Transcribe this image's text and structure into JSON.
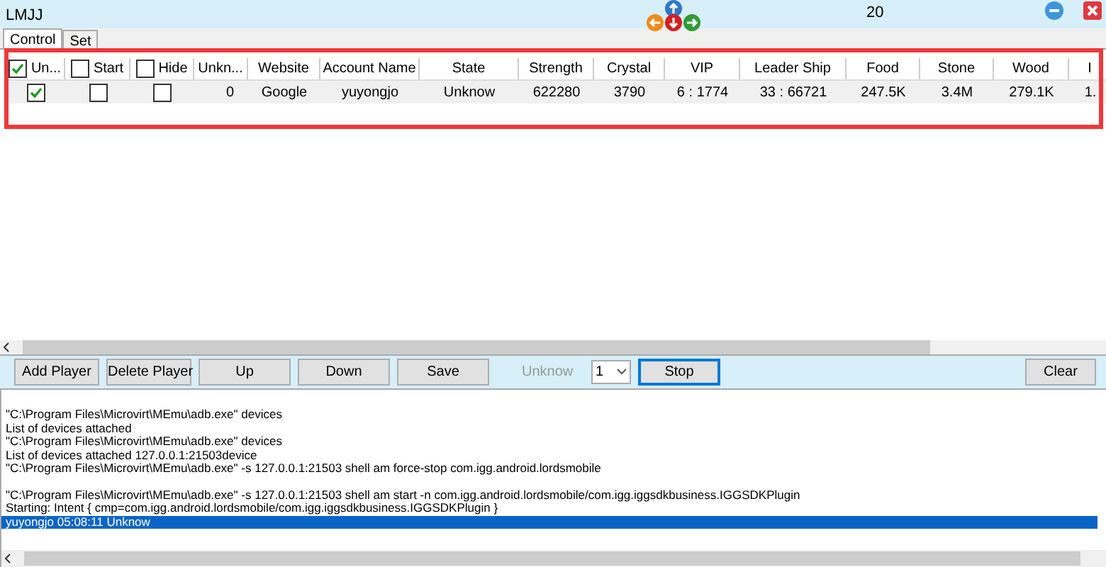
{
  "window": {
    "title": "LMJJ",
    "counter": "20"
  },
  "tabs": [
    {
      "label": "Control",
      "selected": true
    },
    {
      "label": "Set",
      "selected": false
    }
  ],
  "table": {
    "columns": [
      {
        "kind": "check",
        "label": "Un...",
        "checked": true
      },
      {
        "kind": "check",
        "label": "Start",
        "checked": false
      },
      {
        "kind": "check",
        "label": "Hide",
        "checked": false
      },
      {
        "kind": "text",
        "label": "Unkn..."
      },
      {
        "kind": "text",
        "label": "Website"
      },
      {
        "kind": "text",
        "label": "Account Name"
      },
      {
        "kind": "text",
        "label": "State"
      },
      {
        "kind": "text",
        "label": "Strength"
      },
      {
        "kind": "text",
        "label": "Crystal"
      },
      {
        "kind": "text",
        "label": "VIP"
      },
      {
        "kind": "text",
        "label": "Leader Ship"
      },
      {
        "kind": "text",
        "label": "Food"
      },
      {
        "kind": "text",
        "label": "Stone"
      },
      {
        "kind": "text",
        "label": "Wood"
      },
      {
        "kind": "text",
        "label": "I"
      }
    ],
    "rows": [
      {
        "cells": [
          {
            "kind": "check",
            "checked": true
          },
          {
            "kind": "check",
            "checked": false
          },
          {
            "kind": "check",
            "checked": false
          },
          {
            "kind": "text",
            "text": "0"
          },
          {
            "kind": "text",
            "text": "Google"
          },
          {
            "kind": "text",
            "text": "yuyongjo"
          },
          {
            "kind": "text",
            "text": "Unknow"
          },
          {
            "kind": "text",
            "text": "622280"
          },
          {
            "kind": "text",
            "text": "3790"
          },
          {
            "kind": "text",
            "text": "6 : 1774"
          },
          {
            "kind": "text",
            "text": "33 : 66721"
          },
          {
            "kind": "text",
            "text": "247.5K"
          },
          {
            "kind": "text",
            "text": "3.4M"
          },
          {
            "kind": "text",
            "text": "279.1K"
          },
          {
            "kind": "text",
            "text": "1."
          }
        ]
      }
    ]
  },
  "toolbar": {
    "buttons": [
      {
        "label": "Add Player",
        "focused": false
      },
      {
        "label": "Delete Player",
        "focused": false
      },
      {
        "label": "Up",
        "focused": false
      },
      {
        "label": "Down",
        "focused": false
      },
      {
        "label": "Save",
        "focused": false
      }
    ],
    "status": "Unknow",
    "count": "1",
    "stop": {
      "label": "Stop",
      "focused": true
    },
    "clear": "Clear"
  },
  "log": [
    {
      "text": "\"C:\\Program Files\\Microvirt\\MEmu\\adb.exe\" devices",
      "selected": false
    },
    {
      "text": "List of devices attached",
      "selected": false
    },
    {
      "text": "\"C:\\Program Files\\Microvirt\\MEmu\\adb.exe\" devices",
      "selected": false
    },
    {
      "text": "List of devices attached 127.0.0.1:21503device",
      "selected": false
    },
    {
      "text": "\"C:\\Program Files\\Microvirt\\MEmu\\adb.exe\" -s 127.0.0.1:21503 shell am force-stop com.igg.android.lordsmobile",
      "selected": false
    },
    {
      "kind": "blank"
    },
    {
      "text": "\"C:\\Program Files\\Microvirt\\MEmu\\adb.exe\" -s 127.0.0.1:21503 shell am start -n com.igg.android.lordsmobile/com.igg.iggsdkbusiness.IGGSDKPlugin",
      "selected": false
    },
    {
      "text": "Starting: Intent { cmp=com.igg.android.lordsmobile/com.igg.iggsdkbusiness.IGGSDKPlugin }",
      "selected": false
    },
    {
      "text": "yuyongjo   05:08:11  Unknow",
      "selected": true
    }
  ]
}
